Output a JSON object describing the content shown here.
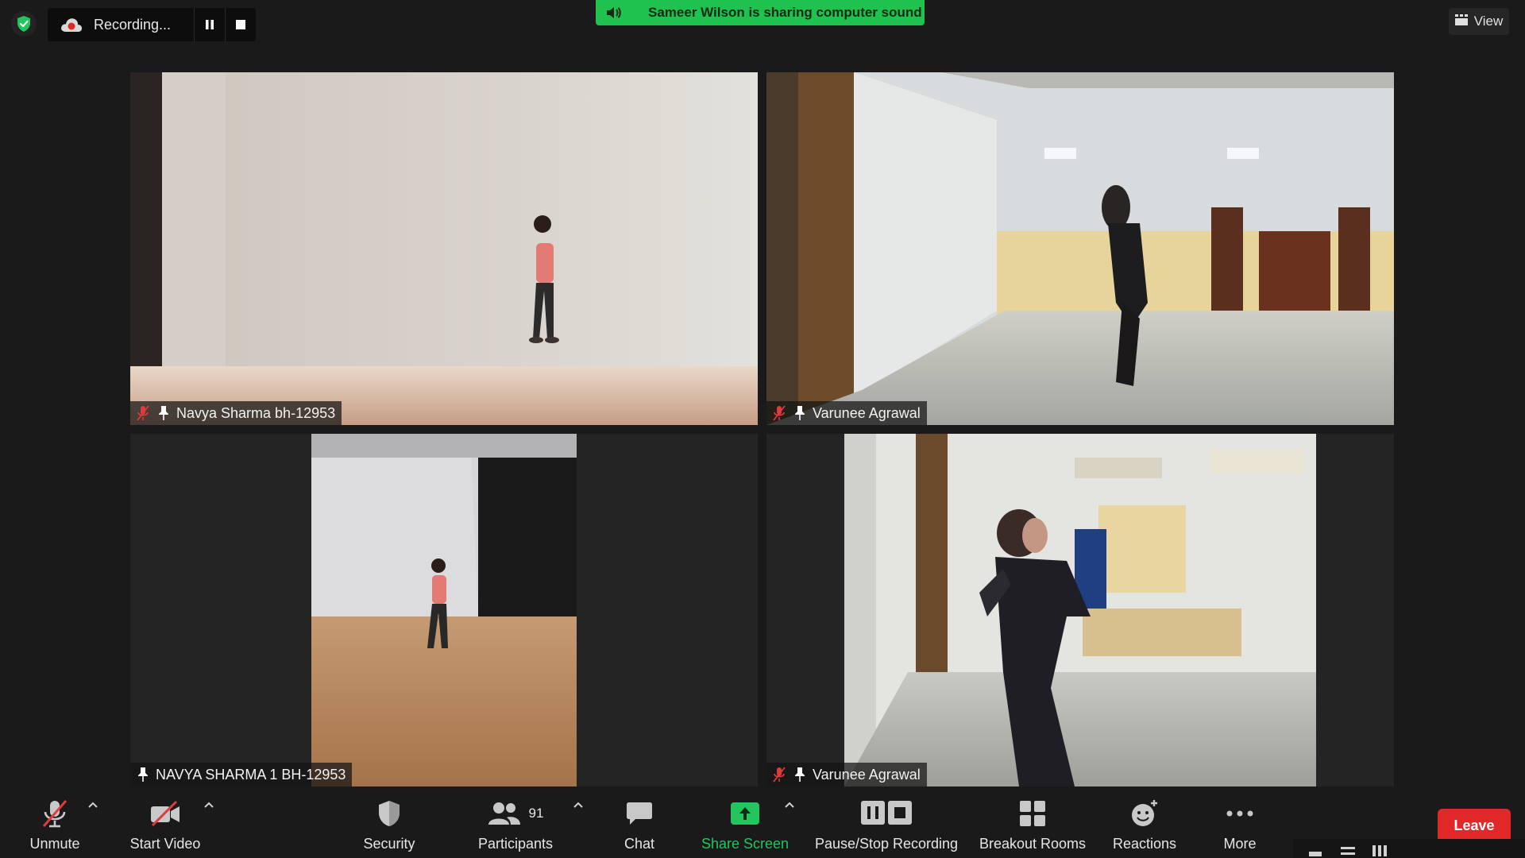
{
  "top_bar": {
    "recording_label": "Recording...",
    "sharing_banner": "Sameer Wilson is sharing computer sound",
    "view_label": "View"
  },
  "tiles": [
    {
      "name": "Navya Sharma bh-12953",
      "muted": true,
      "pinned": true
    },
    {
      "name": "Varunee Agrawal",
      "muted": true,
      "pinned": true
    },
    {
      "name": "NAVYA SHARMA 1 BH-12953",
      "muted": false,
      "pinned": true
    },
    {
      "name": "Varunee Agrawal",
      "muted": true,
      "pinned": true
    }
  ],
  "toolbar": {
    "unmute": "Unmute",
    "start_video": "Start Video",
    "security": "Security",
    "participants": "Participants",
    "participants_count": "91",
    "chat": "Chat",
    "share_screen": "Share Screen",
    "pause_stop_recording": "Pause/Stop Recording",
    "breakout_rooms": "Breakout Rooms",
    "reactions": "Reactions",
    "more": "More",
    "leave": "Leave"
  },
  "colors": {
    "accent_green": "#1fc24f",
    "leave_red": "#e02828",
    "muted_red": "#e03a3a"
  }
}
